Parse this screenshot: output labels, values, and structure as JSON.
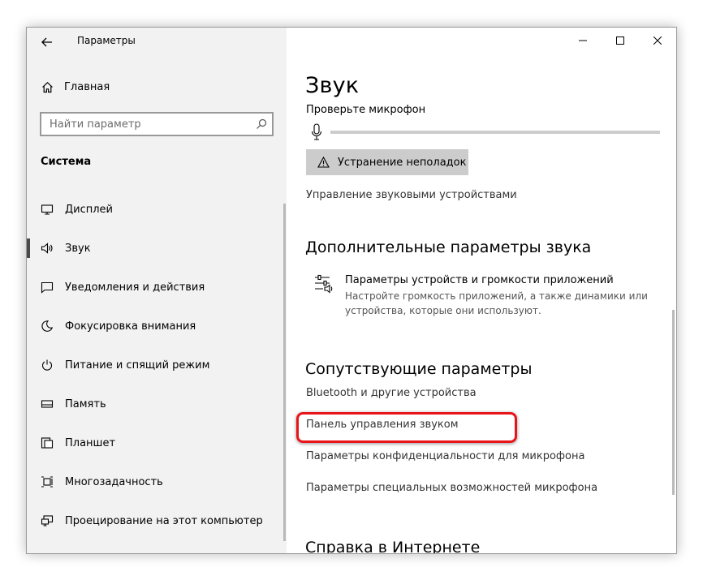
{
  "window": {
    "title": "Параметры",
    "controls": {
      "minimize_icon": "minimize-icon",
      "maximize_icon": "maximize-icon",
      "close_icon": "close-icon"
    }
  },
  "sidebar": {
    "home_label": "Главная",
    "search_placeholder": "Найти параметр",
    "section_title": "Система",
    "items": [
      {
        "label": "Дисплей",
        "icon": "display-icon",
        "selected": false
      },
      {
        "label": "Звук",
        "icon": "speaker-icon",
        "selected": true
      },
      {
        "label": "Уведомления и действия",
        "icon": "notification-icon",
        "selected": false
      },
      {
        "label": "Фокусировка внимания",
        "icon": "moon-icon",
        "selected": false
      },
      {
        "label": "Питание и спящий режим",
        "icon": "power-icon",
        "selected": false
      },
      {
        "label": "Память",
        "icon": "storage-icon",
        "selected": false
      },
      {
        "label": "Планшет",
        "icon": "tablet-icon",
        "selected": false
      },
      {
        "label": "Многозадачность",
        "icon": "multitasking-icon",
        "selected": false
      },
      {
        "label": "Проецирование на этот компьютер",
        "icon": "projecting-icon",
        "selected": false
      }
    ]
  },
  "main": {
    "page_title": "Звук",
    "mic_test_label": "Проверьте микрофон",
    "troubleshoot_label": "Устранение неполадок",
    "manage_devices_link": "Управление звуковыми устройствами",
    "advanced_heading": "Дополнительные параметры звука",
    "app_volume": {
      "title": "Параметры устройств и громкости приложений",
      "description": "Настройте громкость приложений, а также динамики или устройства, которые они используют."
    },
    "related_heading": "Сопутствующие параметры",
    "related_links": [
      "Bluetooth и другие устройства",
      "Панель управления звуком",
      "Параметры конфиденциальности для микрофона",
      "Параметры специальных возможностей микрофона"
    ],
    "help_heading": "Справка в Интернете"
  },
  "colors": {
    "highlight": "#e8141a",
    "sidebar_bg": "#f2f2f2",
    "button_bg": "#cccccc"
  }
}
